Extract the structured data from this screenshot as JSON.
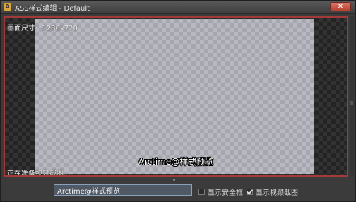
{
  "window": {
    "title": "ASS样式编辑 - Default",
    "app_icon": "a",
    "close_glyph": "✕"
  },
  "preview": {
    "size_label": "画面尺寸:",
    "size_value": "1280x720",
    "subtitle_text": "Arctime@样式预览",
    "status_text": "正在准备视频截图..."
  },
  "bottom": {
    "input_value": "Arctime@样式预览",
    "show_safe_frame": {
      "label": "显示安全框",
      "checked": false
    },
    "show_video_frame": {
      "label": "显示视频截图",
      "checked": true
    }
  }
}
